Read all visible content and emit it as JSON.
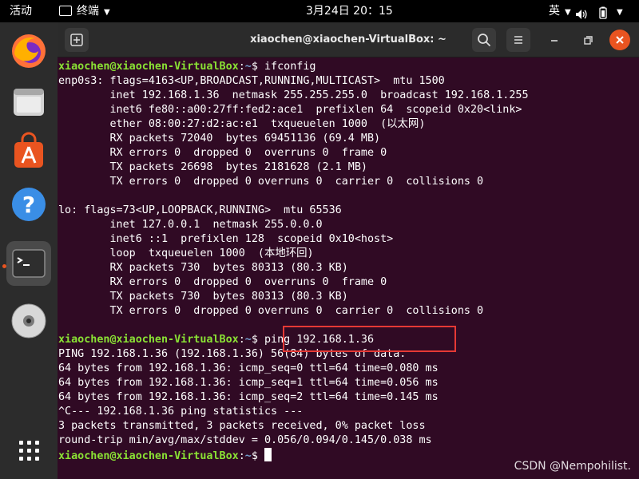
{
  "topbar": {
    "activities": "活动",
    "app_name": "终端",
    "clock": "3月24日  20：15",
    "input_method": "英"
  },
  "dock": {
    "items": [
      "firefox",
      "files",
      "ubuntu-software",
      "help",
      "terminal",
      "dvd"
    ],
    "active": "terminal"
  },
  "window": {
    "title": "xiaochen@xiaochen-VirtualBox: ~"
  },
  "terminal": {
    "prompt_user": "xiaochen@xiaochen-VirtualBox",
    "prompt_sep": ":",
    "prompt_path": "~",
    "prompt_end": "$ ",
    "command1": "ifconfig",
    "command2": "ping 192.168.1.36",
    "output1": [
      "enp0s3: flags=4163<UP,BROADCAST,RUNNING,MULTICAST>  mtu 1500",
      "        inet 192.168.1.36  netmask 255.255.255.0  broadcast 192.168.1.255",
      "        inet6 fe80::a00:27ff:fed2:ace1  prefixlen 64  scopeid 0x20<link>",
      "        ether 08:00:27:d2:ac:e1  txqueuelen 1000  (以太网)",
      "        RX packets 72040  bytes 69451136 (69.4 MB)",
      "        RX errors 0  dropped 0  overruns 0  frame 0",
      "        TX packets 26698  bytes 2181628 (2.1 MB)",
      "        TX errors 0  dropped 0 overruns 0  carrier 0  collisions 0",
      "",
      "lo: flags=73<UP,LOOPBACK,RUNNING>  mtu 65536",
      "        inet 127.0.0.1  netmask 255.0.0.0",
      "        inet6 ::1  prefixlen 128  scopeid 0x10<host>",
      "        loop  txqueuelen 1000  (本地环回)",
      "        RX packets 730  bytes 80313 (80.3 KB)",
      "        RX errors 0  dropped 0  overruns 0  frame 0",
      "        TX packets 730  bytes 80313 (80.3 KB)",
      "        TX errors 0  dropped 0 overruns 0  carrier 0  collisions 0",
      ""
    ],
    "output2": [
      "PING 192.168.1.36 (192.168.1.36) 56(84) bytes of data.",
      "64 bytes from 192.168.1.36: icmp_seq=0 ttl=64 time=0.080 ms",
      "64 bytes from 192.168.1.36: icmp_seq=1 ttl=64 time=0.056 ms",
      "64 bytes from 192.168.1.36: icmp_seq=2 ttl=64 time=0.145 ms",
      "^C--- 192.168.1.36 ping statistics ---",
      "3 packets transmitted, 3 packets received, 0% packet loss",
      "round-trip min/avg/max/stddev = 0.056/0.094/0.145/0.038 ms"
    ]
  },
  "watermark": "CSDN @Nempohilist.",
  "colors": {
    "terminal_bg": "#300a24",
    "prompt_user": "#8ae234",
    "prompt_path": "#729fcf",
    "highlight_box": "#e53935",
    "accent": "#e95420"
  }
}
